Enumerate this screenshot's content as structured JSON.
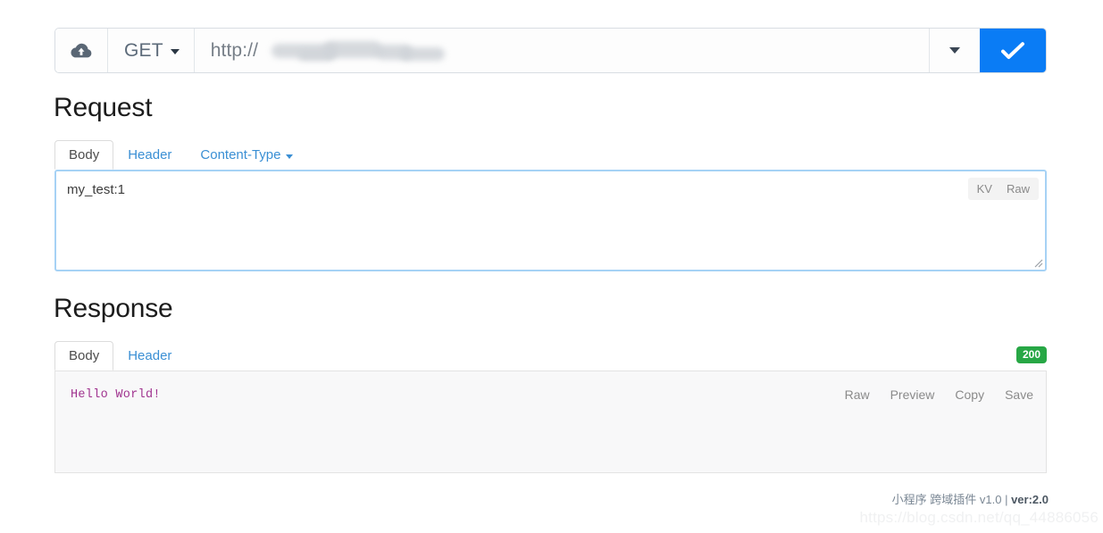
{
  "urlbar": {
    "upload_icon": "cloud-upload-icon",
    "method": "GET",
    "method_caret": "chevron-down-icon",
    "url_value": "http://",
    "url_placeholder": "http://",
    "url_redacted_note": "",
    "history_caret": "chevron-down-icon",
    "send_icon": "check-icon",
    "accent_color": "#0a7cf5"
  },
  "request": {
    "title": "Request",
    "tabs": [
      {
        "label": "Body",
        "active": true
      },
      {
        "label": "Header",
        "active": false
      },
      {
        "label": "Content-Type",
        "active": false,
        "caret": true
      }
    ],
    "body_value": "my_test:1",
    "view_modes": [
      "KV",
      "Raw"
    ]
  },
  "response": {
    "title": "Response",
    "tabs": [
      {
        "label": "Body",
        "active": true
      },
      {
        "label": "Header",
        "active": false
      }
    ],
    "status_code": "200",
    "status_color": "#27a745",
    "body_value": "Hello World!",
    "body_color": "#a0338f",
    "actions": [
      "Raw",
      "Preview",
      "Copy",
      "Save"
    ]
  },
  "footer": {
    "product": "小程序 跨域插件 v1.0 | ",
    "version": "ver:2.0"
  },
  "watermark": {
    "text": "https://blog.csdn.net/qq_44886056"
  }
}
